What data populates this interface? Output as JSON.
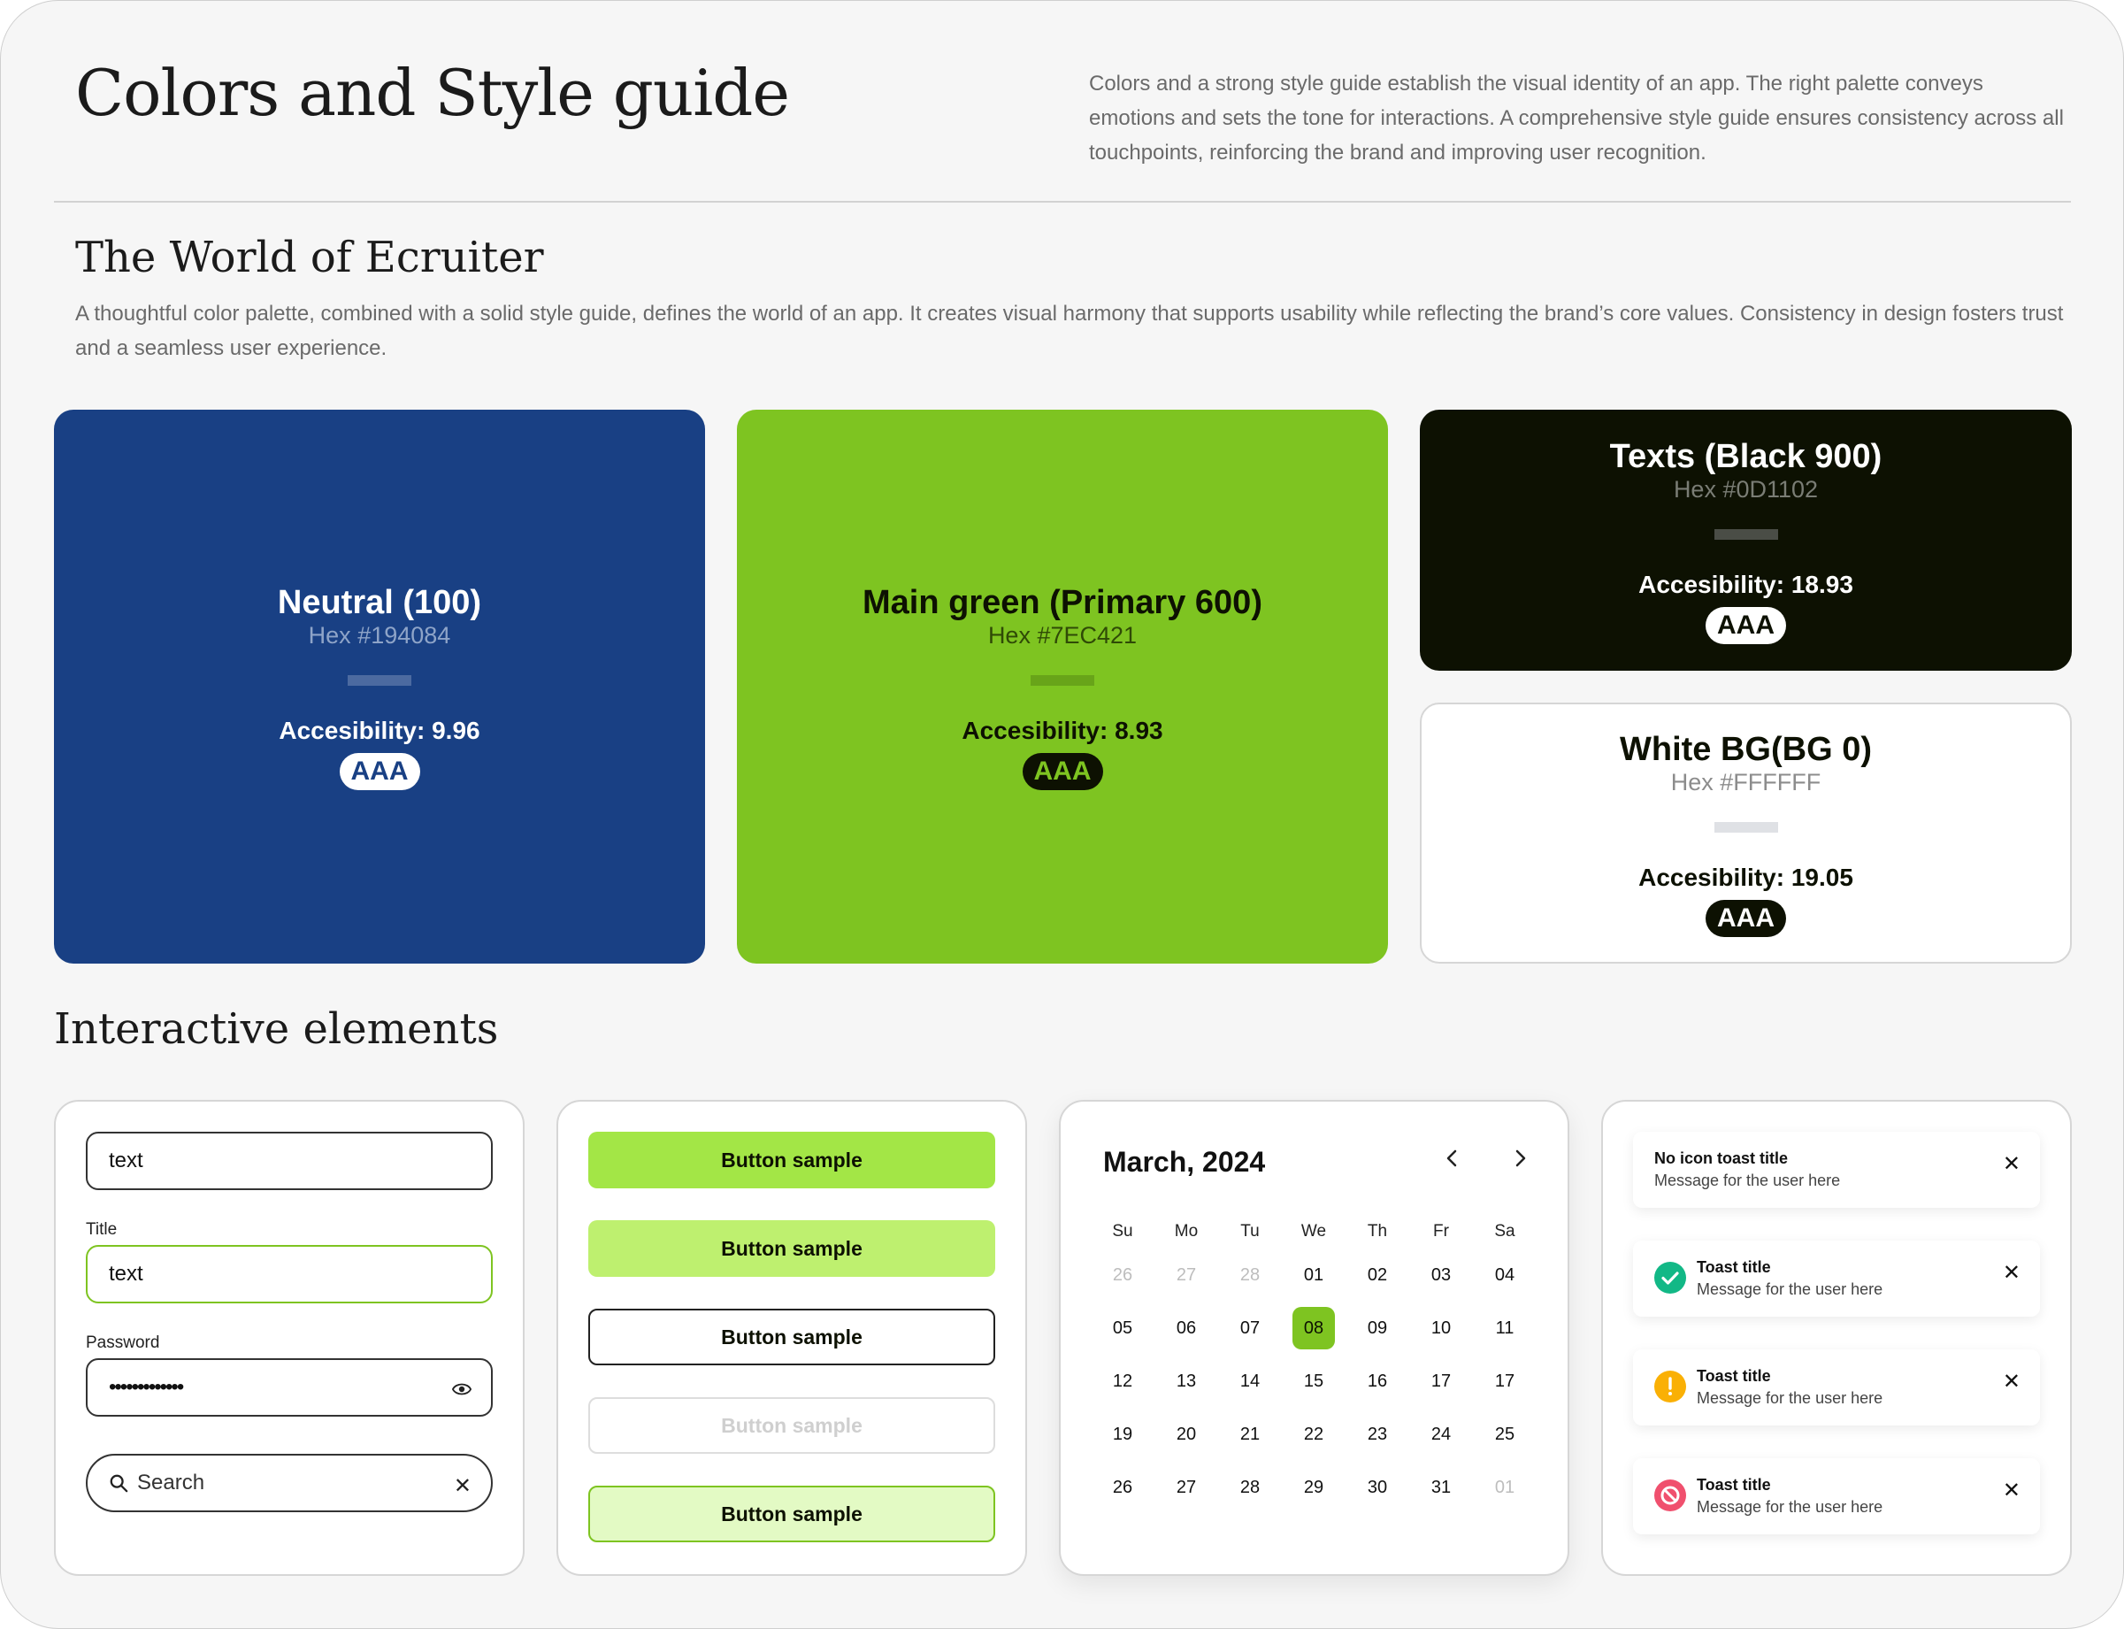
{
  "header": {
    "title": "Colors and Style guide",
    "intro": "Colors and a strong style guide establish the visual identity of an app. The right palette conveys emotions and sets the tone for interactions. A comprehensive style guide ensures consistency across all touchpoints, reinforcing the brand and improving user recognition."
  },
  "world": {
    "title": "The World of Ecruiter",
    "description": "A thoughtful color palette, combined with a solid style guide, defines the world of an app. It creates visual harmony that supports usability while reflecting the brand’s core values. Consistency in design fosters trust and a seamless user experience."
  },
  "colors": [
    {
      "name": "Neutral (100)",
      "hex": "Hex #194084",
      "accessibility": "Accesibility: 9.96",
      "badge": "AAA",
      "color": "#194084"
    },
    {
      "name": "Main green (Primary 600)",
      "hex": "Hex #7EC421",
      "accessibility": "Accesibility: 8.93",
      "badge": "AAA",
      "color": "#7EC421"
    },
    {
      "name": "Texts (Black 900)",
      "hex": "Hex #0D1102",
      "accessibility": "Accesibility: 18.93",
      "badge": "AAA",
      "color": "#0D1102"
    },
    {
      "name": "White BG(BG 0)",
      "hex": "Hex #FFFFFF",
      "accessibility": "Accesibility: 19.05",
      "badge": "AAA",
      "color": "#FFFFFF"
    }
  ],
  "interactive": {
    "title": "Interactive elements",
    "inputs": {
      "field1_value": "text",
      "title_label": "Title",
      "field2_value": "text",
      "password_label": "Password",
      "password_value": "•••••••••••••",
      "search_placeholder": "Search"
    },
    "buttons": [
      "Button sample",
      "Button sample",
      "Button sample",
      "Button sample",
      "Button sample"
    ],
    "calendar": {
      "month": "March, 2024",
      "weekdays": [
        "Su",
        "Mo",
        "Tu",
        "We",
        "Th",
        "Fr",
        "Sa"
      ],
      "weeks": [
        [
          "26",
          "27",
          "28",
          "01",
          "02",
          "03",
          "04"
        ],
        [
          "05",
          "06",
          "07",
          "08",
          "09",
          "10",
          "11"
        ],
        [
          "12",
          "13",
          "14",
          "15",
          "16",
          "17",
          "17"
        ],
        [
          "19",
          "20",
          "21",
          "22",
          "23",
          "24",
          "25"
        ],
        [
          "26",
          "27",
          "28",
          "29",
          "30",
          "31",
          "01"
        ]
      ],
      "selected": "08"
    },
    "toasts": [
      {
        "title": "No icon toast title",
        "message": "Message for the user here",
        "icon": "none"
      },
      {
        "title": "Toast title",
        "message": "Message for the user here",
        "icon": "success-icon",
        "color": "#12B886"
      },
      {
        "title": "Toast title",
        "message": "Message for the user here",
        "icon": "warning-icon",
        "color": "#FAB005"
      },
      {
        "title": "Toast title",
        "message": "Message for the user here",
        "icon": "error-icon",
        "color": "#F0506E"
      }
    ]
  }
}
